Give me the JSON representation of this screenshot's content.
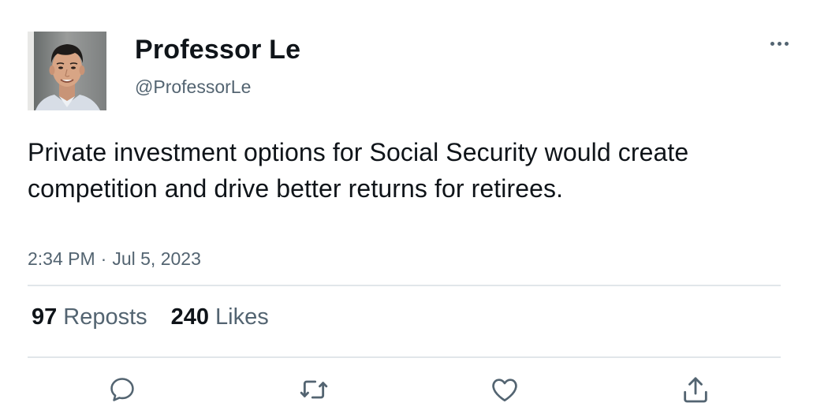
{
  "author": {
    "name": "Professor Le",
    "handle": "@ProfessorLe"
  },
  "tweet": {
    "text": "Private investment options for Social Security would create competition and drive better returns for retirees.",
    "time": "2:34 PM",
    "separator": "·",
    "date": "Jul 5, 2023"
  },
  "stats": {
    "reposts_count": "97",
    "reposts_label": "Reposts",
    "likes_count": "240",
    "likes_label": "Likes"
  },
  "actions": {
    "reply_icon": "reply-icon",
    "repost_icon": "repost-icon",
    "like_icon": "heart-icon",
    "share_icon": "share-icon"
  },
  "colors": {
    "text_primary": "#0f1419",
    "text_secondary": "#536471",
    "divider": "#e1e6ea"
  }
}
